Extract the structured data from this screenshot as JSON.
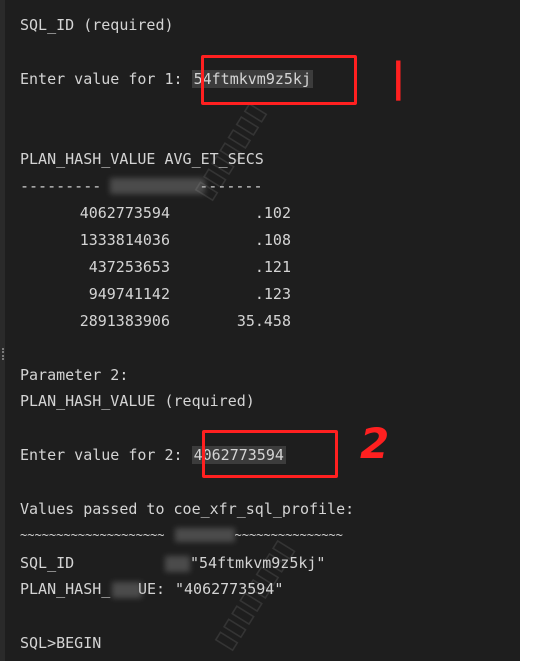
{
  "terminal": {
    "l1": "SQL_ID (required)",
    "l2_prefix": "Enter value for 1:",
    "l2_value": "54ftmkvm9z5kj",
    "header_col1": "PLAN_HASH_VALUE",
    "header_col2": "AVG_ET_SECS",
    "sep_col1": "---------",
    "sep_col2": "-------",
    "rows": [
      {
        "plan_hash_value": "4062773594",
        "avg_et_secs": ".102"
      },
      {
        "plan_hash_value": "1333814036",
        "avg_et_secs": ".108"
      },
      {
        "plan_hash_value": "437253653",
        "avg_et_secs": ".121"
      },
      {
        "plan_hash_value": "949741142",
        "avg_et_secs": ".123"
      },
      {
        "plan_hash_value": "2891383906",
        "avg_et_secs": "35.458"
      }
    ],
    "param2_label": "Parameter 2:",
    "param2_desc": "PLAN_HASH_VALUE (required)",
    "l_enter2_prefix": "Enter value for 2:",
    "l_enter2_value": "4062773594",
    "values_passed": "Values passed to coe_xfr_sql_profile:",
    "tilde_line_a": "~~~~~~~~~~~~~~~~~~~~",
    "tilde_line_b": "~~~~~~~~~~~~~~~",
    "sqlid_label": "SQL_ID",
    "sqlid_value": "\"54ftmkvm9z5kj\"",
    "phv_label_a": "PLAN_HASH_",
    "phv_label_b": "UE:",
    "phv_value": "\"4062773594\"",
    "prompt": "SQL>BEGIN"
  },
  "annotations": {
    "mark1": "|",
    "mark2": "2",
    "color": "#ff2020"
  },
  "theme": {
    "background": "#1e1e1e",
    "text": "#d4d4d4"
  }
}
